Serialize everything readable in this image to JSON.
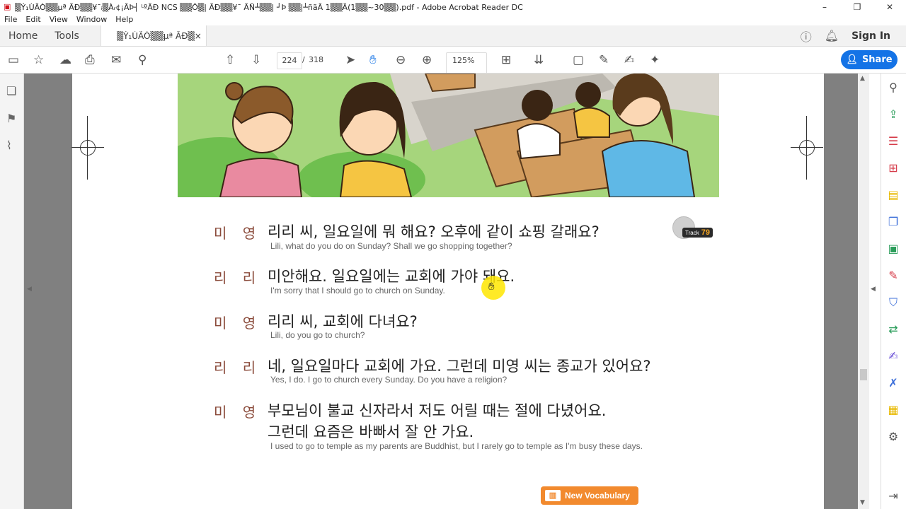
{
  "window": {
    "title": "▒Ý₁ÙÃÒ▒▒µª ÃÐ▒▒¥¯ᵢ▒Àᵣ¢¡ÃÞ┤ ᴸºÃÐ NCS ▒▒Ô▒| ÃÐ▒▒¥¯ ÃÑ┴▒▒| ┘Þ ▒▒|┴ñãÃ 1▒▒Ã(1▒▒~30▒▒).pdf - Adobe Acrobat Reader DC",
    "controls": [
      "–",
      "❐",
      "✕"
    ]
  },
  "menu": [
    "File",
    "Edit",
    "View",
    "Window",
    "Help"
  ],
  "tabs": {
    "home": "Home",
    "tools": "Tools",
    "doc_tab": "▒Ý₁ÙÃÒ▒▒µª ÃÐ▒▒...",
    "close": "×",
    "sign_in": "Sign In"
  },
  "toolbar": {
    "current_page": "224",
    "separator": "/",
    "total_pages": "318",
    "zoom": "125%",
    "share_label": "Share"
  },
  "dialogue": [
    {
      "speaker": "미 영",
      "ko": "리리 씨, 일요일에 뭐 해요? 오후에 같이 쇼핑 갈래요?",
      "en": "Lili, what do you do on Sunday? Shall we go shopping together?"
    },
    {
      "speaker": "리 리",
      "ko": "미안해요. 일요일에는 교회에 가야 돼요.",
      "en": "I'm sorry that I should go to church on Sunday."
    },
    {
      "speaker": "미 영",
      "ko": "리리 씨, 교회에 다녀요?",
      "en": "Lili, do you go to church?"
    },
    {
      "speaker": "리 리",
      "ko": "네, 일요일마다 교회에 가요. 그런데 미영 씨는 종교가 있어요?",
      "en": "Yes, I do. I go to church every Sunday. Do you have a religion?"
    },
    {
      "speaker": "미 영",
      "ko": "부모님이 불교 신자라서 저도 어릴 때는 절에 다녔어요.",
      "ko2": "그런데 요즘은 바빠서 잘 안 가요.",
      "en": "I used to go to temple as my parents are Buddhist, but I rarely go to temple as I'm busy these days."
    }
  ],
  "track": {
    "label": "Track",
    "number": "79"
  },
  "vocab": {
    "label": "New Vocabulary"
  },
  "icons": {
    "left_rail": [
      "pages-icon",
      "bookmark-icon",
      "attachment-icon"
    ],
    "right_rail": [
      "zoom-icon",
      "export-pdf-icon",
      "organize-icon",
      "create-pdf-icon",
      "comment-icon",
      "combine-icon",
      "edit-icon",
      "protect-icon",
      "send-icon",
      "fill-sign-icon",
      "stamp-icon",
      "compress-icon",
      "more-tools-icon"
    ]
  },
  "colors": {
    "accent": "#1473e6",
    "speaker": "#8a4a3a",
    "vocab": "#f28a2e",
    "track_number": "#f5a623"
  }
}
